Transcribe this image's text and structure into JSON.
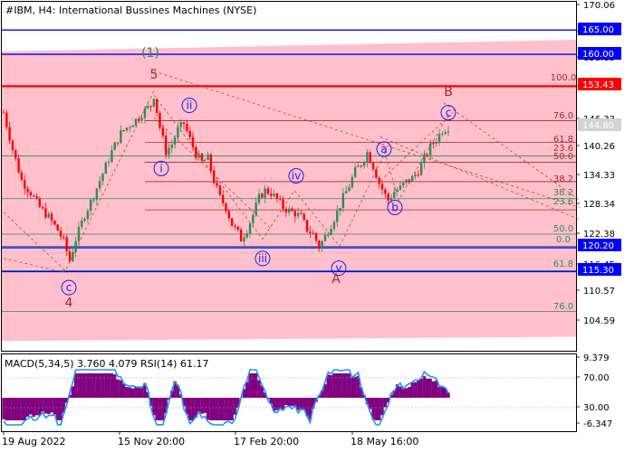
{
  "title": "#IBM, H4:  International Bussines Machines (NYSE)",
  "indicator_title": "MACD(5,34,5) 3.760 4.079 RSI(14) 61.17",
  "colors": {
    "band": "#ffc0cb",
    "blue_level": "#0000ff",
    "red_level": "#ff0000",
    "green_level": "#2e8b57",
    "fib_line": "#a52a2a",
    "wave_label": "#1a1aff",
    "wave_label_red": "#b22222",
    "wave_green": "#2e8b57",
    "candle_up": "#2e8b57",
    "candle_down": "#ff0000",
    "macd_hist": "#800080",
    "rsi_line": "#1e90ff"
  },
  "price_axis": {
    "labels": [
      "170.06",
      "164.19",
      "158.13",
      "152.06",
      "146.33",
      "140.26",
      "134.33",
      "128.34",
      "122.38",
      "116.45",
      "110.57",
      "104.59"
    ],
    "boxes": [
      {
        "text": "165.00",
        "style": "blue"
      },
      {
        "text": "160.00",
        "style": "blue"
      },
      {
        "text": "153.43",
        "style": "red"
      },
      {
        "text": "144.80",
        "style": "gray"
      },
      {
        "text": "120.20",
        "style": "blue"
      },
      {
        "text": "115.30",
        "style": "blue"
      }
    ]
  },
  "fib_labels": [
    {
      "text": "100.0",
      "color": "fib"
    },
    {
      "text": "76.0",
      "color": "fib"
    },
    {
      "text": "61.8",
      "color": "fib"
    },
    {
      "text": "23.6",
      "color": "fib"
    },
    {
      "text": "50.0",
      "color": "fib"
    },
    {
      "text": "38.2",
      "color": "fib"
    },
    {
      "text": "38.2",
      "color": "green"
    },
    {
      "text": "23.6",
      "color": "green"
    },
    {
      "text": "50.0",
      "color": "green"
    },
    {
      "text": "0.0",
      "color": "green"
    },
    {
      "text": "61.8",
      "color": "green"
    },
    {
      "text": "76.0",
      "color": "green"
    }
  ],
  "waves": [
    {
      "text": "(1)",
      "style": "green"
    },
    {
      "text": "5",
      "style": "red"
    },
    {
      "text": "4",
      "style": "red"
    },
    {
      "text": "c",
      "style": "circle"
    },
    {
      "text": "i",
      "style": "circle"
    },
    {
      "text": "ii",
      "style": "circle"
    },
    {
      "text": "iii",
      "style": "circle"
    },
    {
      "text": "iv",
      "style": "circle"
    },
    {
      "text": "v",
      "style": "circle"
    },
    {
      "text": "A",
      "style": "red"
    },
    {
      "text": "a",
      "style": "circle"
    },
    {
      "text": "b",
      "style": "circle"
    },
    {
      "text": "c",
      "style": "circle"
    },
    {
      "text": "B",
      "style": "red"
    }
  ],
  "indicator_axis": {
    "labels": [
      "9.379",
      "70.00",
      "30.00",
      "-6.347"
    ]
  },
  "time_axis": {
    "labels": [
      "19 Aug 2022",
      "15 Nov 20:00",
      "17 Feb 20:00",
      "18 May 16:00"
    ]
  },
  "chart_data": {
    "type": "candlestick",
    "symbol": "#IBM",
    "timeframe": "H4",
    "ylim": [
      101.0,
      171.0
    ],
    "close_path": [
      [
        0,
        148.0
      ],
      [
        3,
        140.5
      ],
      [
        6,
        134.0
      ],
      [
        9,
        131.5
      ],
      [
        12,
        128.5
      ],
      [
        15,
        126.5
      ],
      [
        18,
        123.8
      ],
      [
        20,
        121.5
      ],
      [
        22,
        117.5
      ],
      [
        24,
        122.0
      ],
      [
        27,
        127.0
      ],
      [
        30,
        131.0
      ],
      [
        33,
        135.5
      ],
      [
        36,
        140.0
      ],
      [
        39,
        143.8
      ],
      [
        42,
        145.5
      ],
      [
        45,
        147.0
      ],
      [
        47,
        148.5
      ],
      [
        49,
        149.5
      ],
      [
        50,
        151.6
      ],
      [
        52,
        145.0
      ],
      [
        54,
        140.0
      ],
      [
        56,
        141.5
      ],
      [
        58,
        144.5
      ],
      [
        60,
        145.8
      ],
      [
        62,
        142.5
      ],
      [
        64,
        139.5
      ],
      [
        66,
        137.8
      ],
      [
        68,
        138.6
      ],
      [
        70,
        134.0
      ],
      [
        72,
        130.5
      ],
      [
        74,
        128.5
      ],
      [
        76,
        125.0
      ],
      [
        78,
        123.2
      ],
      [
        79,
        122.0
      ],
      [
        81,
        124.0
      ],
      [
        83,
        127.0
      ],
      [
        85,
        130.5
      ],
      [
        87,
        132.0
      ],
      [
        89,
        131.5
      ],
      [
        91,
        130.2
      ],
      [
        93,
        128.5
      ],
      [
        95,
        127.8
      ],
      [
        97,
        127.3
      ],
      [
        99,
        126.5
      ],
      [
        101,
        124.0
      ],
      [
        103,
        123.0
      ],
      [
        105,
        120.4
      ],
      [
        107,
        122.5
      ],
      [
        109,
        125.0
      ],
      [
        111,
        127.5
      ],
      [
        113,
        130.5
      ],
      [
        115,
        133.0
      ],
      [
        117,
        136.0
      ],
      [
        119,
        137.5
      ],
      [
        121,
        139.8
      ],
      [
        123,
        137.0
      ],
      [
        125,
        133.5
      ],
      [
        127,
        131.0
      ],
      [
        128,
        130.0
      ],
      [
        130,
        131.8
      ],
      [
        132,
        132.5
      ],
      [
        134,
        133.8
      ],
      [
        136,
        134.5
      ],
      [
        138,
        136.0
      ],
      [
        140,
        138.5
      ],
      [
        142,
        141.0
      ],
      [
        144,
        142.5
      ],
      [
        146,
        144.4
      ],
      [
        148,
        145.0
      ]
    ],
    "horizontal_levels": [
      {
        "value": 165.0,
        "kind": "blue"
      },
      {
        "value": 160.0,
        "kind": "blue"
      },
      {
        "value": 153.43,
        "kind": "red"
      },
      {
        "value": 120.2,
        "kind": "blue"
      },
      {
        "value": 115.3,
        "kind": "blue"
      },
      {
        "value": 144.8,
        "kind": "current_price"
      }
    ],
    "fib_retracement": {
      "levels": [
        100.0,
        76.0,
        61.8,
        50.0,
        38.2,
        23.6
      ]
    },
    "fib_extension": {
      "levels": [
        38.2,
        23.6,
        50.0,
        0.0,
        61.8,
        76.0
      ]
    },
    "macd": {
      "fast": 5,
      "slow": 34,
      "signal": 5,
      "values": [
        3.76,
        4.079
      ]
    },
    "rsi": {
      "period": 14,
      "value": 61.17
    },
    "indicator_levels": [
      70.0,
      30.0
    ],
    "indicator_ylim": [
      -6.347,
      9.379
    ],
    "x_tick_labels": [
      "19 Aug 2022",
      "15 Nov 20:00",
      "17 Feb 20:00",
      "18 May 16:00"
    ]
  }
}
